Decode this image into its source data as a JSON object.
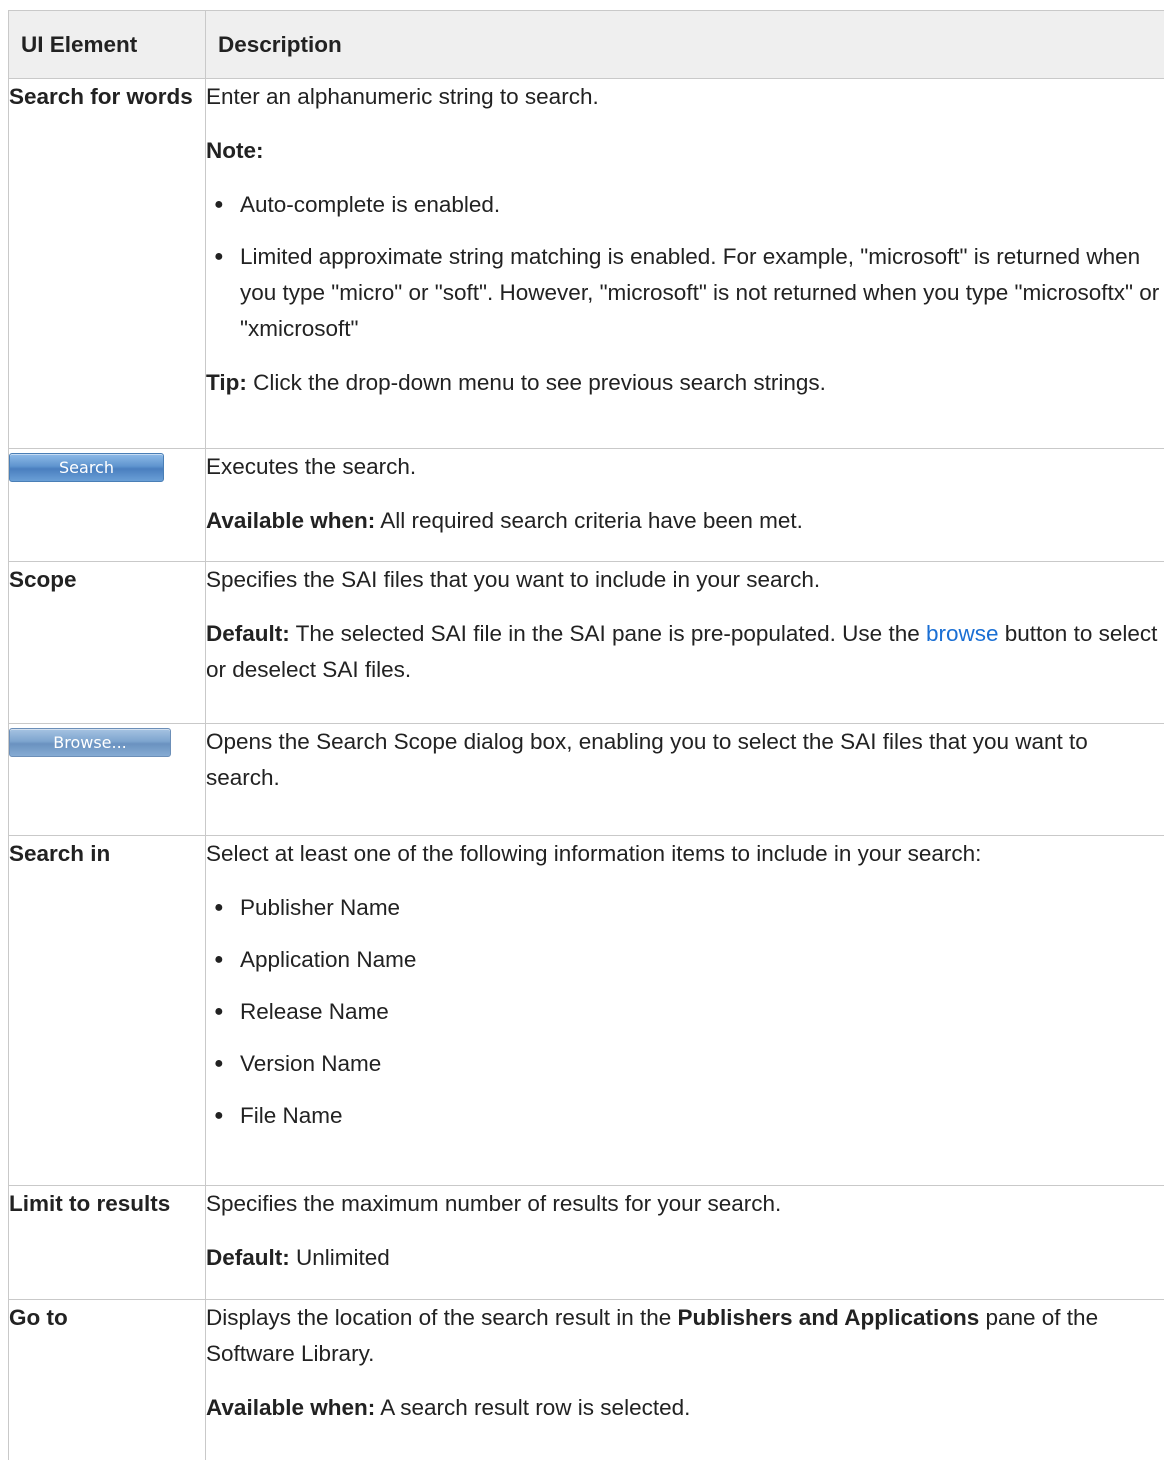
{
  "table": {
    "headers": [
      "UI Element",
      "Description"
    ],
    "search_for_words": {
      "element": "Search for words",
      "intro": "Enter an alphanumeric string to search.",
      "note_label": "Note:",
      "bullets": [
        "Auto-complete is enabled.",
        "Limited approximate string matching is enabled. For example, \"microsoft\" is returned when you type \"micro\" or \"soft\". However, \"microsoft\" is not returned when you type \"microsoftx\" or \"xmicrosoft\""
      ],
      "tip_label": "Tip:",
      "tip_text": " Click the drop-down menu to see previous search strings."
    },
    "search_button": {
      "button_label": "Search",
      "desc": "Executes the search.",
      "avail_label": "Available when:",
      "avail_text": "  All required search criteria have been met."
    },
    "scope": {
      "element": "Scope",
      "desc": "Specifies the SAI files that you want to include in your search.",
      "default_label": "Default:",
      "default_text_1": " The selected SAI file in the SAI pane is pre-populated. Use the ",
      "default_link": "browse",
      "default_text_2": " button to select or deselect SAI files."
    },
    "browse_button": {
      "button_label": "Browse...",
      "desc": "Opens the Search Scope dialog box, enabling you to select the SAI files that you want to search."
    },
    "search_in": {
      "element": "Search in",
      "desc": "Select at least one of the following information items to include in your search:",
      "items": [
        "Publisher Name",
        "Application Name",
        "Release Name",
        "Version Name",
        "File Name"
      ]
    },
    "limit_to_results": {
      "element": "Limit to results",
      "desc": "Specifies the maximum number of results for your search.",
      "default_label": "Default:",
      "default_text": " Unlimited"
    },
    "go_to": {
      "element": "Go to",
      "desc_1": "Displays the location of the search result in the ",
      "desc_bold": "Publishers and Applications",
      "desc_2": " pane of the Software Library.",
      "avail_label": "Available when:",
      "avail_text": " A search result row is selected."
    }
  },
  "colors": {
    "header_bg": "#efefef",
    "border": "#c9c9c9",
    "link": "#1a6fd4",
    "button_blue": "#5f95cf"
  }
}
